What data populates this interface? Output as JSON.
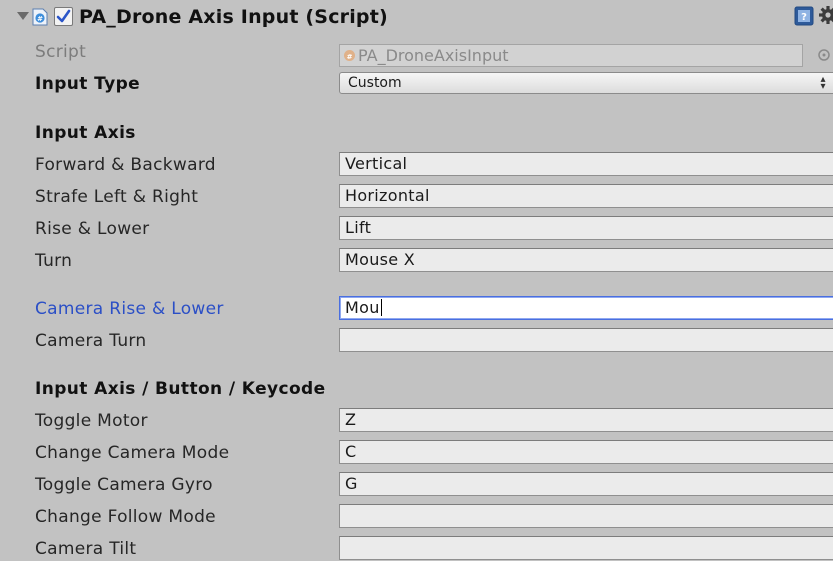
{
  "component": {
    "title": "PA_Drone Axis Input (Script)",
    "enabled": true
  },
  "script": {
    "label": "Script",
    "value": "PA_DroneAxisInput"
  },
  "input_type": {
    "label": "Input Type",
    "value": "Custom"
  },
  "input_axis": {
    "header": "Input Axis",
    "rows": [
      {
        "label": "Forward & Backward",
        "value": "Vertical"
      },
      {
        "label": "Strafe Left & Right",
        "value": "Horizontal"
      },
      {
        "label": "Rise & Lower",
        "value": "Lift"
      },
      {
        "label": "Turn",
        "value": "Mouse X"
      }
    ]
  },
  "camera": {
    "rows": [
      {
        "label": "Camera Rise & Lower",
        "value": "Mou",
        "focused": true
      },
      {
        "label": "Camera Turn",
        "value": ""
      }
    ]
  },
  "keycodes": {
    "header": "Input Axis / Button / Keycode",
    "rows": [
      {
        "label": "Toggle Motor",
        "value": "Z"
      },
      {
        "label": "Change Camera Mode",
        "value": "C"
      },
      {
        "label": "Toggle Camera Gyro",
        "value": "G"
      },
      {
        "label": "Change Follow Mode",
        "value": ""
      },
      {
        "label": "Camera Tilt",
        "value": ""
      }
    ]
  },
  "colors": {
    "background": "#c2c2c2",
    "focus_label": "#2b4fc6",
    "focus_border": "#4a6fe0"
  },
  "icons": {
    "foldout": "foldout-arrow-icon",
    "script": "csharp-script-icon",
    "checkbox": "checkmark-icon",
    "help": "help-book-icon",
    "settings": "gear-icon",
    "object_picker": "object-picker-icon",
    "dropdown": "dropdown-arrows-icon"
  }
}
